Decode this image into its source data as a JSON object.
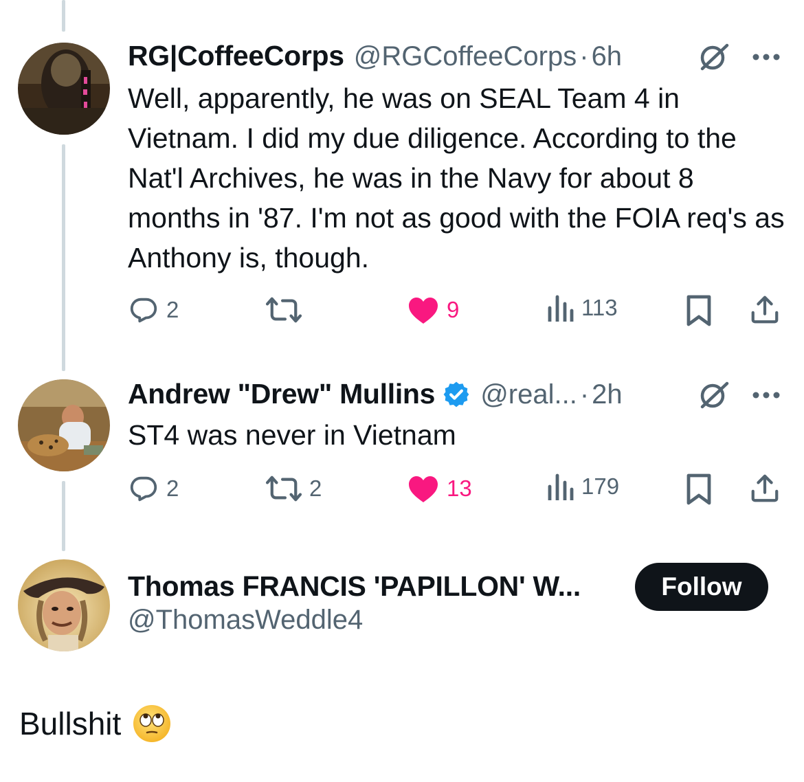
{
  "thread": [
    {
      "display_name": "RG|CoffeeCorps",
      "handle": "@RGCoffeeCorps",
      "separator": "·",
      "time": "6h",
      "text": "Well, apparently, he was on SEAL Team 4 in Vietnam. I did my due diligence. According to the Nat'l Archives, he was in the Navy for about 8 months in '87. I'm not as good with the FOIA req's as Anthony is, though.",
      "replies": "2",
      "reposts": "",
      "likes": "9",
      "views": "113",
      "verified": false
    },
    {
      "display_name": "Andrew \"Drew\" Mullins",
      "handle": "@real...",
      "separator": "·",
      "time": "2h",
      "text": "ST4 was never in Vietnam",
      "replies": "2",
      "reposts": "2",
      "likes": "13",
      "views": "179",
      "verified": true
    }
  ],
  "main_post": {
    "display_name": "Thomas FRANCIS 'PAPILLON' W...",
    "handle": "@ThomasWeddle4",
    "follow_label": "Follow",
    "text": "Bullshit",
    "emoji": "face-with-rolling-eyes"
  },
  "colors": {
    "text": "#0f1419",
    "secondary": "#536471",
    "like": "#f91880",
    "verified": "#1d9bf0",
    "thread_line": "#cfd9de",
    "follow_bg": "#0f1419"
  }
}
